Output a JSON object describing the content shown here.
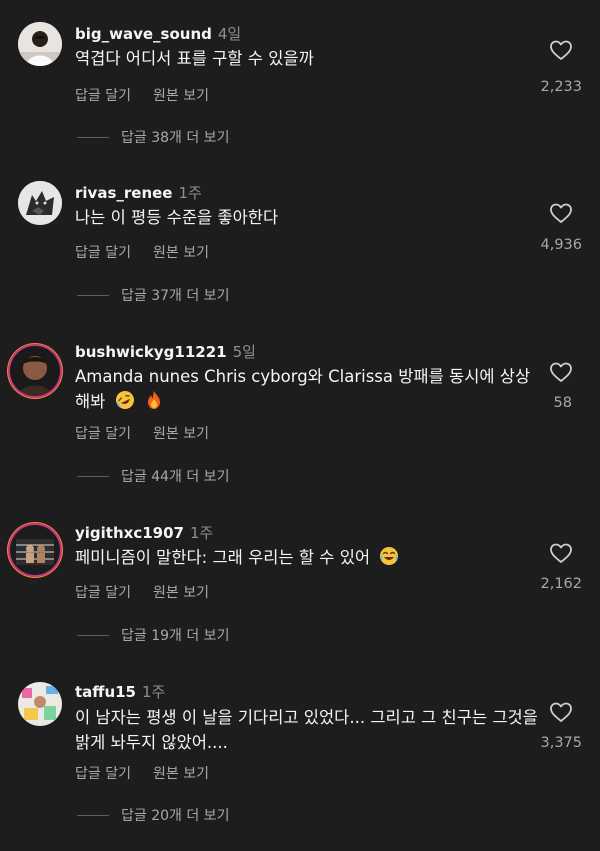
{
  "comments": [
    {
      "username": "big_wave_sound",
      "time": "4일",
      "text": "역겹다 어디서 표를 구할 수 있을까",
      "likes": "2,233",
      "reply_label": "답글 달기",
      "original_label": "원본 보기",
      "more_replies": "답글 38개 더 보기",
      "avatar_icon": "person-white-tee-avatar"
    },
    {
      "username": "rivas_renee",
      "time": "1주",
      "text": "나는 이 평등 수준을 좋아한다",
      "likes": "4,936",
      "reply_label": "답글 달기",
      "original_label": "원본 보기",
      "more_replies": "답글 37개 더 보기",
      "avatar_icon": "wolf-avatar"
    },
    {
      "username": "bushwickyg11221",
      "time": "5일",
      "text": "Amanda nunes Chris cyborg와 Clarissa 방패를 동시에 상상해봐",
      "emoji_icons": [
        "rolling-laughing-emoji-icon",
        "fire-emoji-icon"
      ],
      "likes": "58",
      "reply_label": "답글 달기",
      "original_label": "원본 보기",
      "more_replies": "답글 44개 더 보기",
      "avatar_icon": "story-ring-avatar"
    },
    {
      "username": "yigithxc1907",
      "time": "1주",
      "text": "페미니즘이 말한다: 그래 우리는 할 수 있어",
      "emoji_icons": [
        "tears-of-joy-emoji-icon"
      ],
      "likes": "2,162",
      "reply_label": "답글 달기",
      "original_label": "원본 보기",
      "more_replies": "답글 19개 더 보기",
      "avatar_icon": "boxing-ring-avatar"
    },
    {
      "username": "taffu15",
      "time": "1주",
      "text": "이 남자는 평생 이 날을 기다리고 있었다... 그리고 그 친구는 그것을 밝게 놔두지 않았어....",
      "likes": "3,375",
      "reply_label": "답글 달기",
      "original_label": "원본 보기",
      "more_replies": "답글 20개 더 보기",
      "avatar_icon": "colorful-room-avatar"
    }
  ],
  "colors": {
    "background": "#1d1d1e",
    "text_primary": "#f5f5f5",
    "text_secondary": "#a8a8a8"
  }
}
